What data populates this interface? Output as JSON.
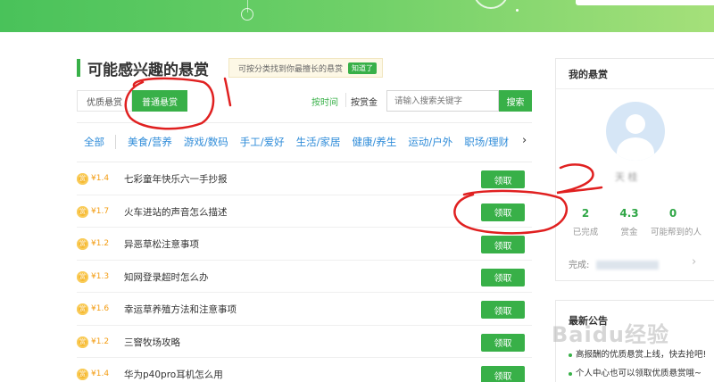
{
  "page": {
    "title": "可能感兴趣的悬赏",
    "tip": "可按分类找到你最擅长的悬赏",
    "tip_ok": "知道了"
  },
  "type_tabs": [
    {
      "label": "优质悬赏"
    },
    {
      "label": "普通悬赏",
      "active": true
    }
  ],
  "sort": {
    "time": "按时间",
    "money": "按赏金"
  },
  "search": {
    "placeholder": "请输入搜索关键字",
    "button": "搜索"
  },
  "categories": [
    "全部",
    "美食/营养",
    "游戏/数码",
    "手工/爱好",
    "生活/家居",
    "健康/养生",
    "运动/户外",
    "职场/理财"
  ],
  "categories_more": "›",
  "coin_glyph": "赏",
  "claim_label": "领取",
  "questions": [
    {
      "reward": "¥1.4",
      "title": "七彩童年快乐六一手抄报"
    },
    {
      "reward": "¥1.7",
      "title": "火车进站的声音怎么描述"
    },
    {
      "reward": "¥1.2",
      "title": "异恶草松注意事项"
    },
    {
      "reward": "¥1.3",
      "title": "知网登录超时怎么办"
    },
    {
      "reward": "¥1.6",
      "title": "幸运草养殖方法和注意事项"
    },
    {
      "reward": "¥1.2",
      "title": "三窨牧场攻略"
    },
    {
      "reward": "¥1.4",
      "title": "华为p40pro耳机怎么用"
    }
  ],
  "my_bounty": {
    "title": "我的悬赏",
    "username": "天 桂",
    "stats": [
      {
        "value": "2",
        "label": "已完成"
      },
      {
        "value": "4.3",
        "label": "赏金"
      },
      {
        "value": "0",
        "label": "可能帮到的人"
      }
    ],
    "complete_label": "完成:",
    "arrow": "›"
  },
  "announcements": {
    "title": "最新公告",
    "items": [
      "高报酬的优质悬赏上线，快去抢吧!",
      "个人中心也可以领取优质悬赏哦~"
    ]
  },
  "watermark": "Baidu经验",
  "colors": {
    "accent": "#38b048",
    "link": "#2f8cd9",
    "reward": "#f39c12",
    "annotation": "#e02020"
  }
}
